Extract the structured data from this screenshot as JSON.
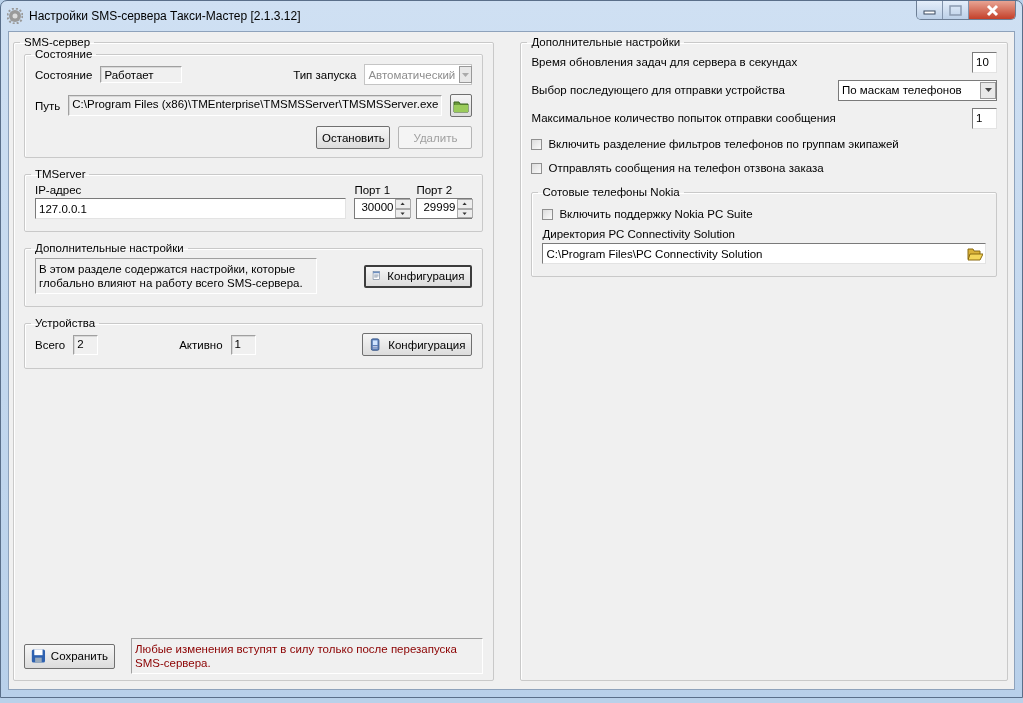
{
  "window": {
    "title": "Настройки SMS-сервера Такси-Мастер [2.1.3.12]"
  },
  "sms_server": {
    "title": "SMS-сервер",
    "state_group": {
      "title": "Состояние",
      "state_label": "Состояние",
      "state_value": "Работает",
      "launch_label": "Тип запуска",
      "launch_value": "Автоматический",
      "launch_disabled": true,
      "path_label": "Путь",
      "path_value": "C:\\Program Files (x86)\\TMEnterprise\\TMSMSServer\\TMSMSServer.exe",
      "buttons": [
        {
          "label": "Остановить",
          "disabled": false
        },
        {
          "label": "Удалить",
          "disabled": true
        }
      ]
    },
    "tmserver": {
      "title": "TMServer",
      "ip_label": "IP-адрес",
      "ip_value": "127.0.0.1",
      "ports": [
        {
          "label": "Порт 1",
          "value": "30000"
        },
        {
          "label": "Порт 2",
          "value": "29999"
        }
      ]
    },
    "extra": {
      "title": "Дополнительные настройки",
      "description": "В этом разделе содержатся настройки, которые глобально влияют на работу всего SMS-сервера.",
      "button": "Конфигурация"
    },
    "devices": {
      "title": "Устройства",
      "total_label": "Всего",
      "total_value": "2",
      "active_label": "Активно",
      "active_value": "1",
      "button": "Конфигурация"
    },
    "save_button": "Сохранить",
    "notice": "Любые изменения вступят в силу только после перезапуска SMS-сервера."
  },
  "additional": {
    "title": "Дополнительные настройки",
    "rows": [
      {
        "kind": "number",
        "label": "Время обновления задач для сервера в секундах",
        "value": "10"
      },
      {
        "kind": "select",
        "label": "Выбор последующего для отправки устройства",
        "value": "По маскам телефонов"
      },
      {
        "kind": "number",
        "label": "Максимальное количество попыток отправки сообщения",
        "value": "1"
      },
      {
        "kind": "checkbox",
        "label": "Включить разделение фильтров телефонов по группам экипажей",
        "checked": false
      },
      {
        "kind": "checkbox",
        "label": "Отправлять сообщения на телефон отзвона заказа",
        "checked": false
      }
    ],
    "nokia": {
      "title": "Сотовые телефоны Nokia",
      "checkbox": {
        "label": "Включить поддержку Nokia PC Suite",
        "checked": false
      },
      "dir_label": "Директория PC Connectivity Solution",
      "dir_value": "C:\\Program Files\\PC Connectivity Solution"
    }
  }
}
